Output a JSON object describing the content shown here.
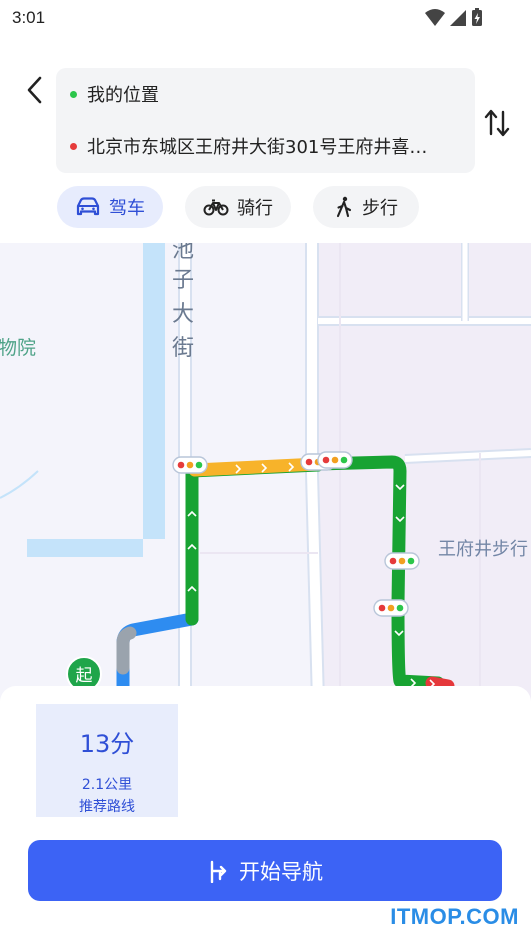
{
  "status_bar": {
    "time": "3:01"
  },
  "route": {
    "origin": "我的位置",
    "destination": "北京市东城区王府井大街301号王府井喜…"
  },
  "modes": [
    {
      "label": "驾车",
      "icon": "car-icon",
      "active": true
    },
    {
      "label": "骑行",
      "icon": "bike-icon",
      "active": false
    },
    {
      "label": "步行",
      "icon": "walk-icon",
      "active": false
    }
  ],
  "map": {
    "labels": {
      "street_1": "池",
      "street_2": "子",
      "street_3": "大",
      "street_4": "街",
      "poi_left": "物院",
      "poi_right": "王府井步行",
      "start_marker": "起"
    }
  },
  "result": {
    "time": "13分",
    "distance": "2.1公里",
    "tag": "推荐路线"
  },
  "actions": {
    "start_navigation": "开始导航"
  },
  "watermark": "ITMOP.COM",
  "colors": {
    "accent": "#3c63f5",
    "route_green": "#18a332",
    "route_orange": "#f7b32a",
    "route_blue": "#2e8cf0"
  }
}
